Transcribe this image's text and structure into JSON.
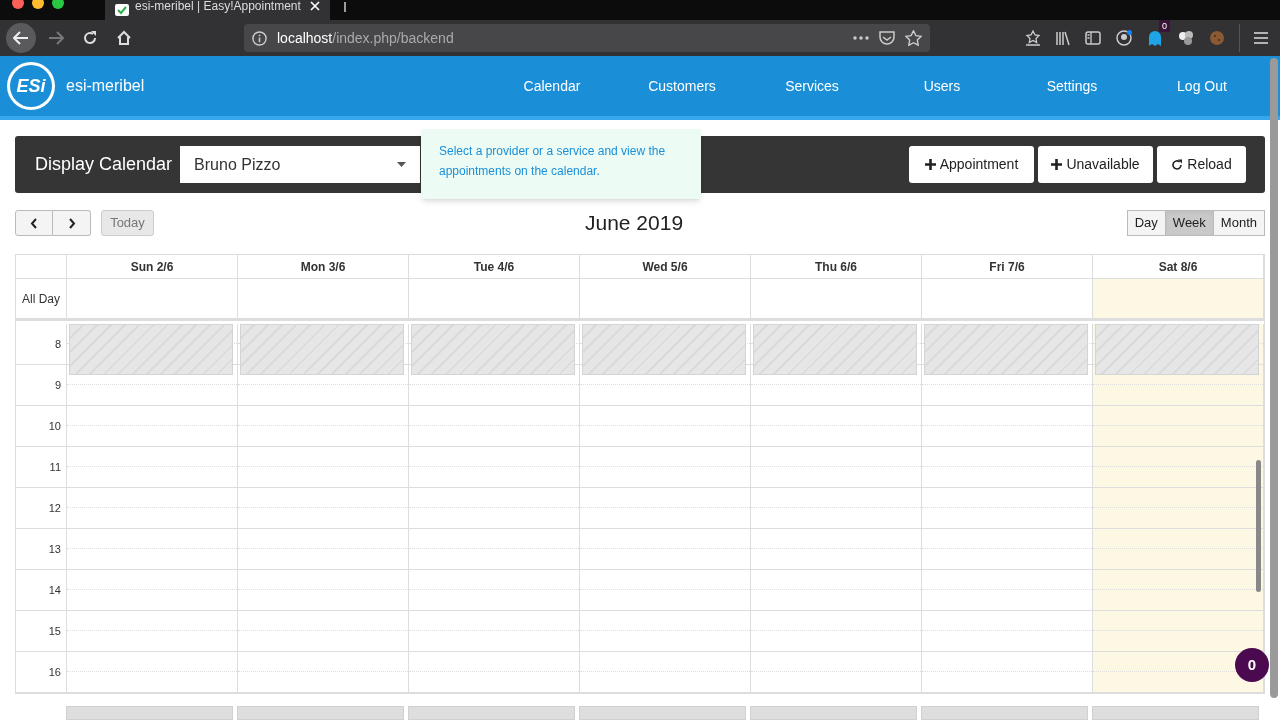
{
  "browser": {
    "tab_title": "esi-meribel | Easy!Appointment",
    "url_host": "localhost",
    "url_path": "/index.php/backend",
    "extension_badge": "0"
  },
  "app": {
    "brand": "esi-meribel",
    "logo_text": "ESi"
  },
  "nav": [
    {
      "label": "Calendar"
    },
    {
      "label": "Customers"
    },
    {
      "label": "Services"
    },
    {
      "label": "Users"
    },
    {
      "label": "Settings"
    },
    {
      "label": "Log Out"
    }
  ],
  "toolbar": {
    "label": "Display Calendar",
    "provider": "Bruno Pizzo",
    "tooltip": "Select a provider or a service and view the appointments on the calendar.",
    "buttons": [
      {
        "kind": "add",
        "label": "Appointment"
      },
      {
        "kind": "add",
        "label": "Unavailable"
      },
      {
        "kind": "reload",
        "label": "Reload"
      }
    ]
  },
  "calendar": {
    "title": "June 2019",
    "today_button": "Today",
    "views": [
      {
        "label": "Day",
        "selected": false
      },
      {
        "label": "Week",
        "selected": true
      },
      {
        "label": "Month",
        "selected": false
      }
    ],
    "all_day_label": "All Day",
    "days": [
      {
        "label": "Sun 2/6",
        "today": false
      },
      {
        "label": "Mon 3/6",
        "today": false
      },
      {
        "label": "Tue 4/6",
        "today": false
      },
      {
        "label": "Wed 5/6",
        "today": false
      },
      {
        "label": "Thu 6/6",
        "today": false
      },
      {
        "label": "Fri 7/6",
        "today": false
      },
      {
        "label": "Sat 8/6",
        "today": true
      }
    ],
    "hours": [
      {
        "label": "8",
        "unavailable": true
      },
      {
        "label": "9",
        "unavailable": false
      },
      {
        "label": "10",
        "unavailable": false
      },
      {
        "label": "11",
        "unavailable": false
      },
      {
        "label": "12",
        "unavailable": false
      },
      {
        "label": "13",
        "unavailable": false
      },
      {
        "label": "14",
        "unavailable": false
      },
      {
        "label": "15",
        "unavailable": false
      },
      {
        "label": "16",
        "unavailable": false
      }
    ]
  },
  "notification_badge": "0"
}
